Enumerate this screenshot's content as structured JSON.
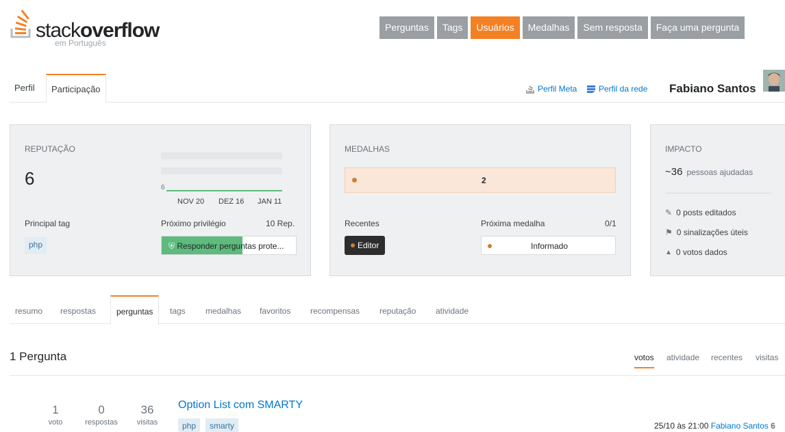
{
  "brand": {
    "logo_pre": "stack",
    "logo_bold": "overflow",
    "logo_sub": "em Português"
  },
  "topnav": [
    "Perguntas",
    "Tags",
    "Usuários",
    "Medalhas",
    "Sem resposta",
    "Faça uma pergunta"
  ],
  "profile_tabs": {
    "perfil": "Perfil",
    "participacao": "Participação"
  },
  "links": {
    "perfil_meta": "Perfil Meta",
    "perfil_rede": "Perfil da rede"
  },
  "user": {
    "name": "Fabiano Santos"
  },
  "reputation": {
    "title": "REPUTAÇÃO",
    "value": "6",
    "graph_label": "6",
    "dates": [
      "NOV 20",
      "DEZ 16",
      "JAN 11"
    ],
    "top_tag_label": "Principal tag",
    "top_tag": "php",
    "next_privilege_label": "Próximo privilégio",
    "next_privilege_rep": "10 Rep.",
    "next_privilege_text": "Responder perguntas prote...",
    "next_privilege_progress": 0.6
  },
  "badges": {
    "title": "MEDALHAS",
    "bronze_count": "2",
    "recent_label": "Recentes",
    "recent_badge": "Editor",
    "next_label": "Próxima medalha",
    "next_progress": "0/1",
    "next_badge": "Informado",
    "bronze_color": "#cd7f32"
  },
  "impact": {
    "title": "IMPACTO",
    "people_num": "~36",
    "people_text": "pessoas ajudadas",
    "edited": "0 posts editados",
    "flags": "0 sinalizações úteis",
    "votes": "0 votos dados"
  },
  "subtabs": [
    "resumo",
    "respostas",
    "perguntas",
    "tags",
    "medalhas",
    "favoritos",
    "recompensas",
    "reputação",
    "atividade"
  ],
  "questions_header": "1 Pergunta",
  "sorts": [
    "votos",
    "atividade",
    "recentes",
    "visitas"
  ],
  "question": {
    "votes": "1",
    "votes_label": "voto",
    "answers": "0",
    "answers_label": "respostas",
    "views": "36",
    "views_label": "visitas",
    "title": "Option List com SMARTY",
    "tags": [
      "php",
      "smarty"
    ],
    "date": "25/10 às 21:00",
    "author": "Fabiano Santos",
    "author_rep": "6"
  },
  "colors": {
    "accent": "#f48024",
    "nav_gray": "#9a9fa4",
    "green": "#5eba7d",
    "link": "#0077cc"
  }
}
